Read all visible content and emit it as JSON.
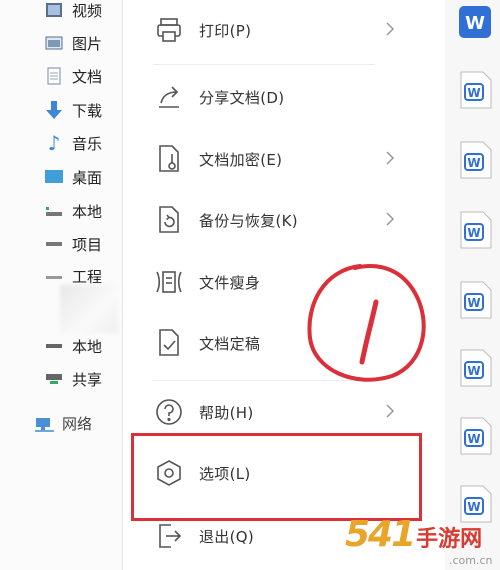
{
  "sidebar": {
    "items": [
      {
        "label": "视频",
        "icon": "video-folder-icon"
      },
      {
        "label": "图片",
        "icon": "pictures-folder-icon"
      },
      {
        "label": "文档",
        "icon": "documents-folder-icon"
      },
      {
        "label": "下载",
        "icon": "download-arrow-icon"
      },
      {
        "label": "音乐",
        "icon": "music-note-icon"
      },
      {
        "label": "桌面",
        "icon": "desktop-icon"
      },
      {
        "label": "本地",
        "icon": "local-disk-icon"
      },
      {
        "label": "项目",
        "icon": "project-drive-icon"
      },
      {
        "label": "工程",
        "icon": "project-drive-icon"
      },
      {
        "label": "本地",
        "icon": "local-disk-icon"
      },
      {
        "label": "共享",
        "icon": "shared-drive-icon"
      }
    ],
    "network": {
      "label": "网络",
      "icon": "network-icon"
    }
  },
  "menu": {
    "items": [
      {
        "label": "打印(P)",
        "icon": "printer-icon",
        "has_submenu": true
      },
      {
        "label": "分享文档(D)",
        "icon": "share-icon",
        "has_submenu": false
      },
      {
        "label": "文档加密(E)",
        "icon": "encrypt-document-icon",
        "has_submenu": true
      },
      {
        "label": "备份与恢复(K)",
        "icon": "backup-restore-icon",
        "has_submenu": true
      },
      {
        "label": "文件瘦身",
        "icon": "slim-file-icon",
        "has_submenu": false
      },
      {
        "label": "文档定稿",
        "icon": "finalize-document-icon",
        "has_submenu": false
      },
      {
        "label": "帮助(H)",
        "icon": "help-icon",
        "has_submenu": true
      },
      {
        "label": "选项(L)",
        "icon": "options-hexagon-icon",
        "has_submenu": false
      },
      {
        "label": "退出(Q)",
        "icon": "exit-icon",
        "has_submenu": false
      }
    ],
    "highlighted_item": "选项(L)"
  },
  "annotation": {
    "handwritten_mark": "1",
    "color": "#d9303a"
  },
  "doc_list": {
    "icon": "wps-writer-doc-icon",
    "accent": "#2f6fd6"
  },
  "watermark": {
    "number": "541",
    "text": "手游网",
    "domain": ".com.cn"
  },
  "colors": {
    "highlight": "#d9303a",
    "brand": "#2f6fd6"
  }
}
